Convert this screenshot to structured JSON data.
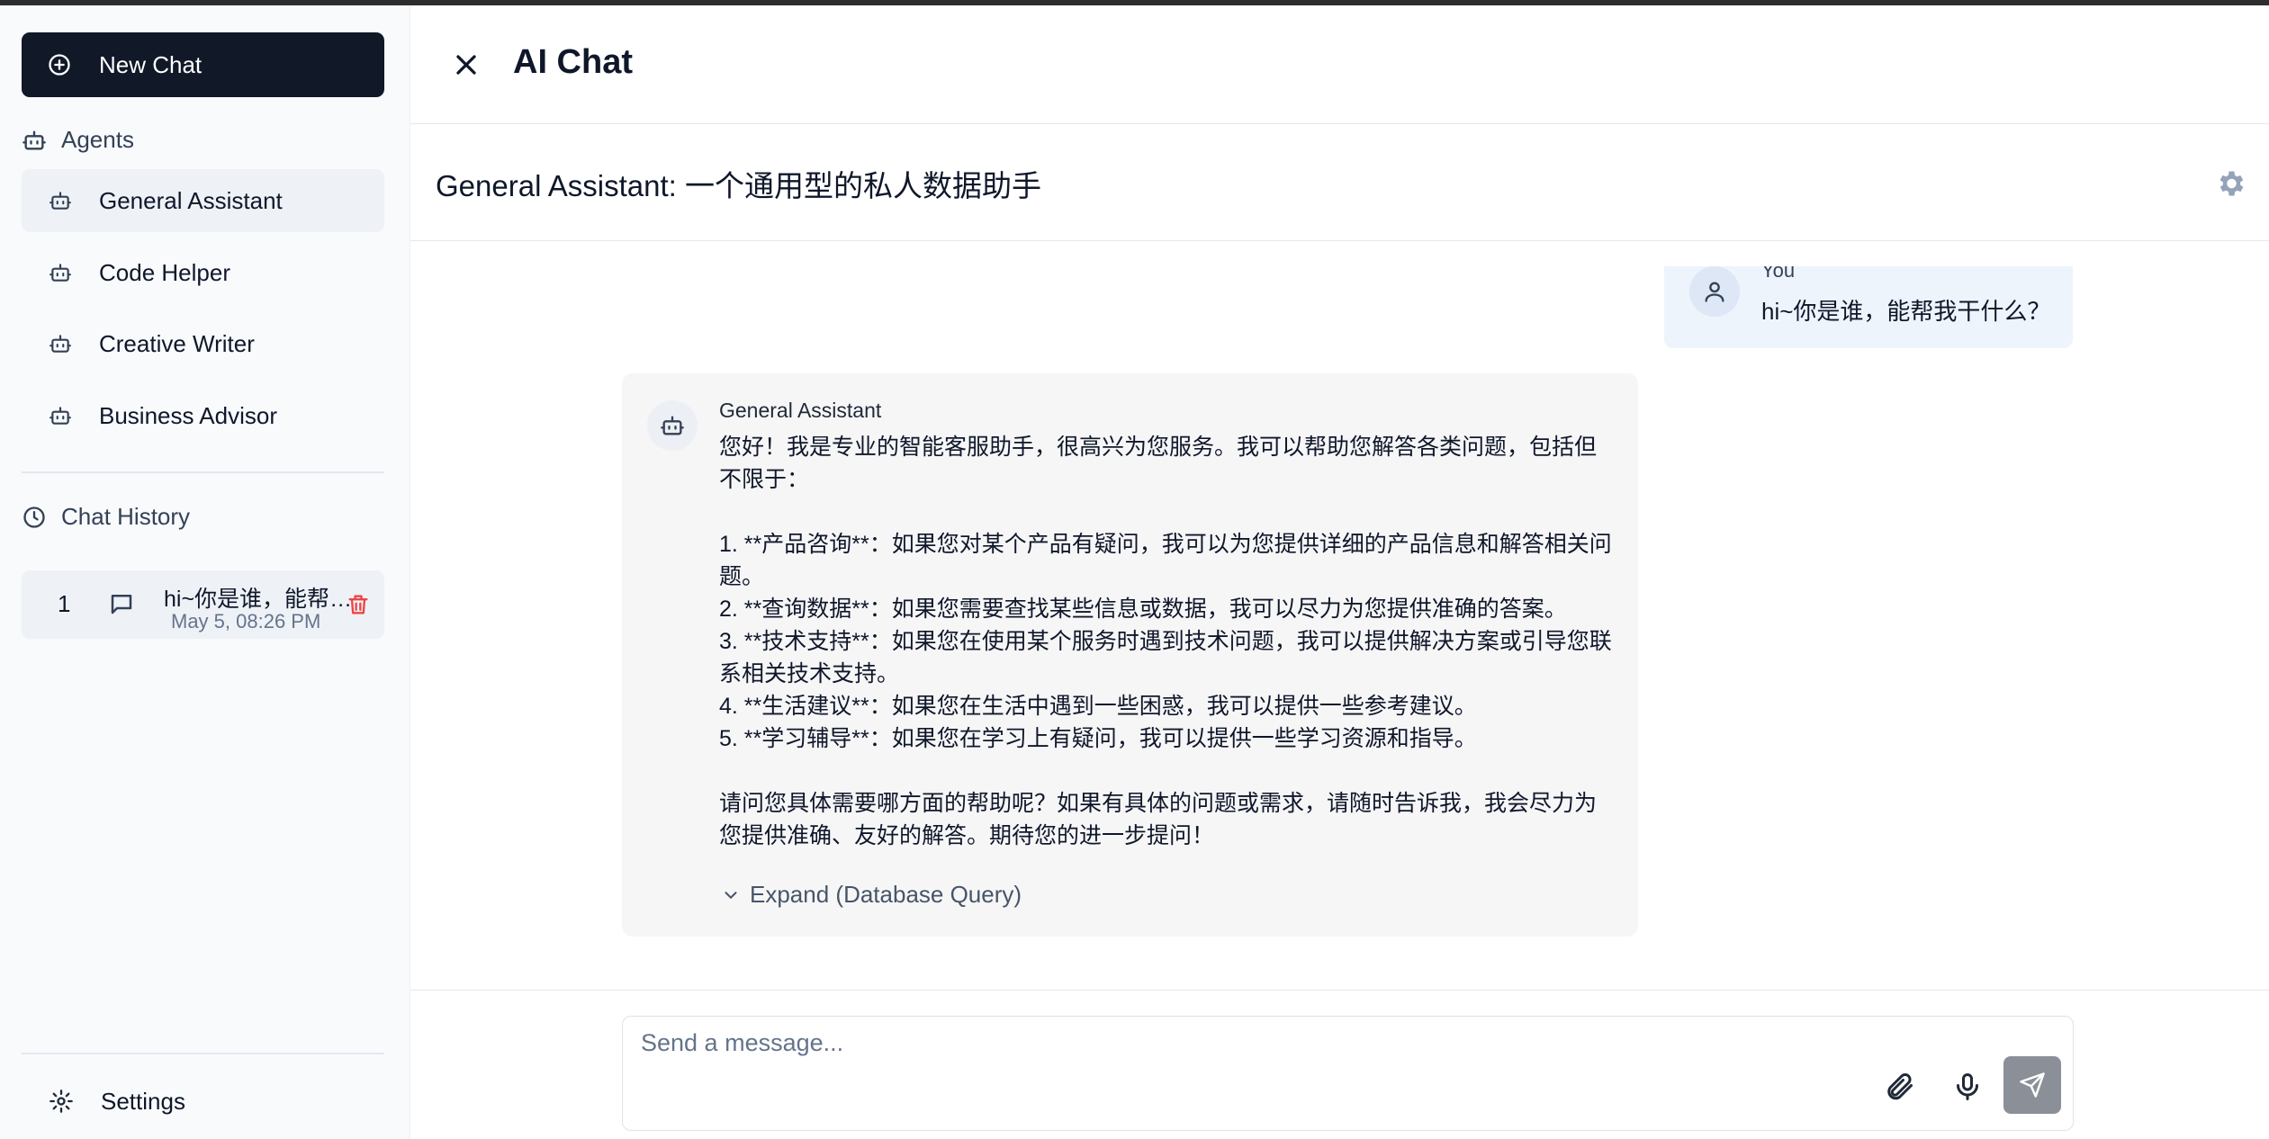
{
  "app": {
    "title": "AI Chat"
  },
  "sidebar": {
    "new_chat_label": "New Chat",
    "agents_heading": "Agents",
    "agents": [
      {
        "label": "General Assistant",
        "active": true
      },
      {
        "label": "Code Helper",
        "active": false
      },
      {
        "label": "Creative Writer",
        "active": false
      },
      {
        "label": "Business Advisor",
        "active": false
      }
    ],
    "history_heading": "Chat History",
    "history": [
      {
        "index": "1",
        "title": "hi~你是谁，能帮我干什么？",
        "time": "May 5, 08:26 PM"
      }
    ],
    "settings_label": "Settings"
  },
  "chat": {
    "agent_heading": "General Assistant: 一个通用型的私人数据助手",
    "messages": [
      {
        "role": "user",
        "sender": "You",
        "text": "hi~你是谁，能帮我干什么？"
      },
      {
        "role": "assistant",
        "sender": "General Assistant",
        "lines": [
          "您好！我是专业的智能客服助手，很高兴为您服务。我可以帮助您解答各类问题，包括但不限于：",
          "",
          "1. **产品咨询**：如果您对某个产品有疑问，我可以为您提供详细的产品信息和解答相关问题。",
          "2. **查询数据**：如果您需要查找某些信息或数据，我可以尽力为您提供准确的答案。",
          "3. **技术支持**：如果您在使用某个服务时遇到技术问题，我可以提供解决方案或引导您联系相关技术支持。",
          "4. **生活建议**：如果您在生活中遇到一些困惑，我可以提供一些参考建议。",
          "5. **学习辅导**：如果您在学习上有疑问，我可以提供一些学习资源和指导。",
          "",
          "请问您具体需要哪方面的帮助呢？如果有具体的问题或需求，请随时告诉我，我会尽力为您提供准确、友好的解答。期待您的进一步提问！"
        ],
        "expand_label": "Expand (Database Query)"
      }
    ]
  },
  "composer": {
    "placeholder": "Send a message...",
    "value": ""
  },
  "colors": {
    "primary_dark": "#111827",
    "danger": "#ef4444",
    "send_disabled": "#8a8f98",
    "user_bubble": "#eef4fc",
    "bot_bubble": "#f6f6f7"
  }
}
